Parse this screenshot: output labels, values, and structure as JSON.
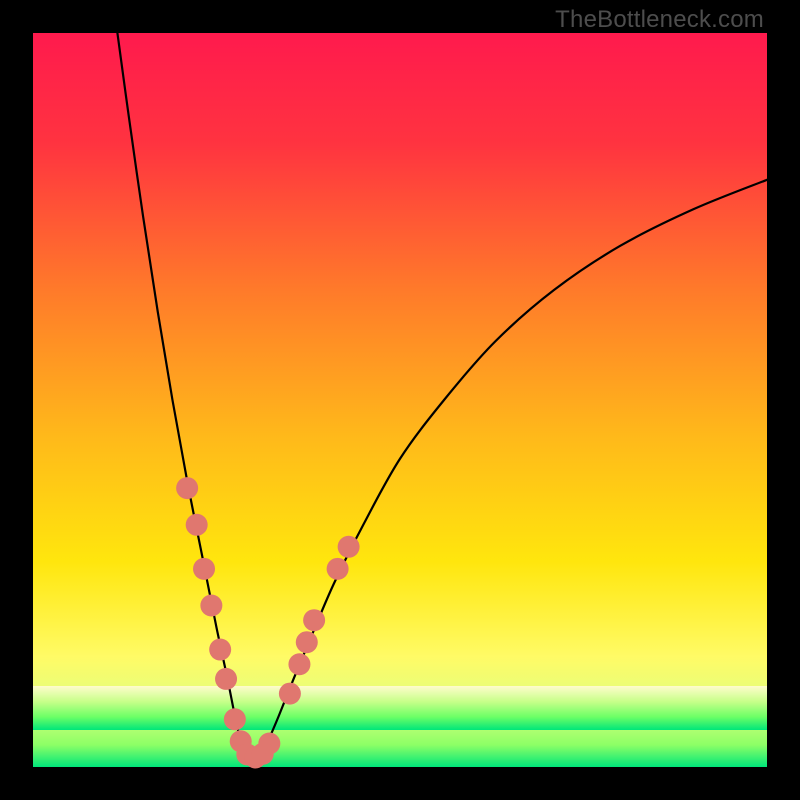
{
  "watermark": {
    "text": "TheBottleneck.com"
  },
  "chart_data": {
    "type": "line",
    "title": "",
    "xlabel": "",
    "ylabel": "",
    "xlim": [
      0,
      100
    ],
    "ylim": [
      0,
      100
    ],
    "grid": false,
    "legend": false,
    "gradient": {
      "stops": [
        {
          "pos": 0.0,
          "color": "#ff1a4d"
        },
        {
          "pos": 0.15,
          "color": "#ff3340"
        },
        {
          "pos": 0.35,
          "color": "#ff7a2a"
        },
        {
          "pos": 0.55,
          "color": "#ffb91a"
        },
        {
          "pos": 0.72,
          "color": "#ffe60d"
        },
        {
          "pos": 0.85,
          "color": "#fffb66"
        },
        {
          "pos": 0.92,
          "color": "#dfff80"
        },
        {
          "pos": 0.97,
          "color": "#8cff66"
        },
        {
          "pos": 1.0,
          "color": "#00e67a"
        }
      ]
    },
    "green_band": {
      "y_from": 5,
      "y_to": 11,
      "gradient": [
        {
          "pos": 0.0,
          "color": "#fffccc"
        },
        {
          "pos": 0.35,
          "color": "#c8ff8a"
        },
        {
          "pos": 0.7,
          "color": "#6dff66"
        },
        {
          "pos": 1.0,
          "color": "#00e67a"
        }
      ]
    },
    "series": [
      {
        "name": "left-curve",
        "stroke": "#000000",
        "stroke_width": 2.2,
        "x": [
          11.5,
          13,
          15,
          17,
          19,
          21,
          23,
          25,
          26.5,
          27.5,
          28.3,
          29
        ],
        "y": [
          100,
          89,
          75,
          62,
          50,
          39,
          29,
          19,
          12,
          7,
          3.5,
          1.5
        ]
      },
      {
        "name": "right-curve",
        "stroke": "#000000",
        "stroke_width": 2.2,
        "x": [
          31,
          32,
          33.5,
          35.5,
          38,
          41,
          45,
          50,
          56,
          63,
          71,
          80,
          90,
          100
        ],
        "y": [
          1.5,
          3.5,
          7,
          12,
          18,
          25,
          33,
          42,
          50,
          58,
          65,
          71,
          76,
          80
        ]
      }
    ],
    "dots": {
      "fill": "#e0776f",
      "r": 11,
      "points": [
        {
          "x": 21.0,
          "y": 38
        },
        {
          "x": 22.3,
          "y": 33
        },
        {
          "x": 23.3,
          "y": 27
        },
        {
          "x": 24.3,
          "y": 22
        },
        {
          "x": 25.5,
          "y": 16
        },
        {
          "x": 26.3,
          "y": 12
        },
        {
          "x": 27.5,
          "y": 6.5
        },
        {
          "x": 28.3,
          "y": 3.5
        },
        {
          "x": 29.2,
          "y": 1.7
        },
        {
          "x": 30.3,
          "y": 1.3
        },
        {
          "x": 31.3,
          "y": 1.8
        },
        {
          "x": 32.2,
          "y": 3.2
        },
        {
          "x": 35.0,
          "y": 10
        },
        {
          "x": 36.3,
          "y": 14
        },
        {
          "x": 37.3,
          "y": 17
        },
        {
          "x": 38.3,
          "y": 20
        },
        {
          "x": 41.5,
          "y": 27
        },
        {
          "x": 43.0,
          "y": 30
        }
      ]
    }
  }
}
